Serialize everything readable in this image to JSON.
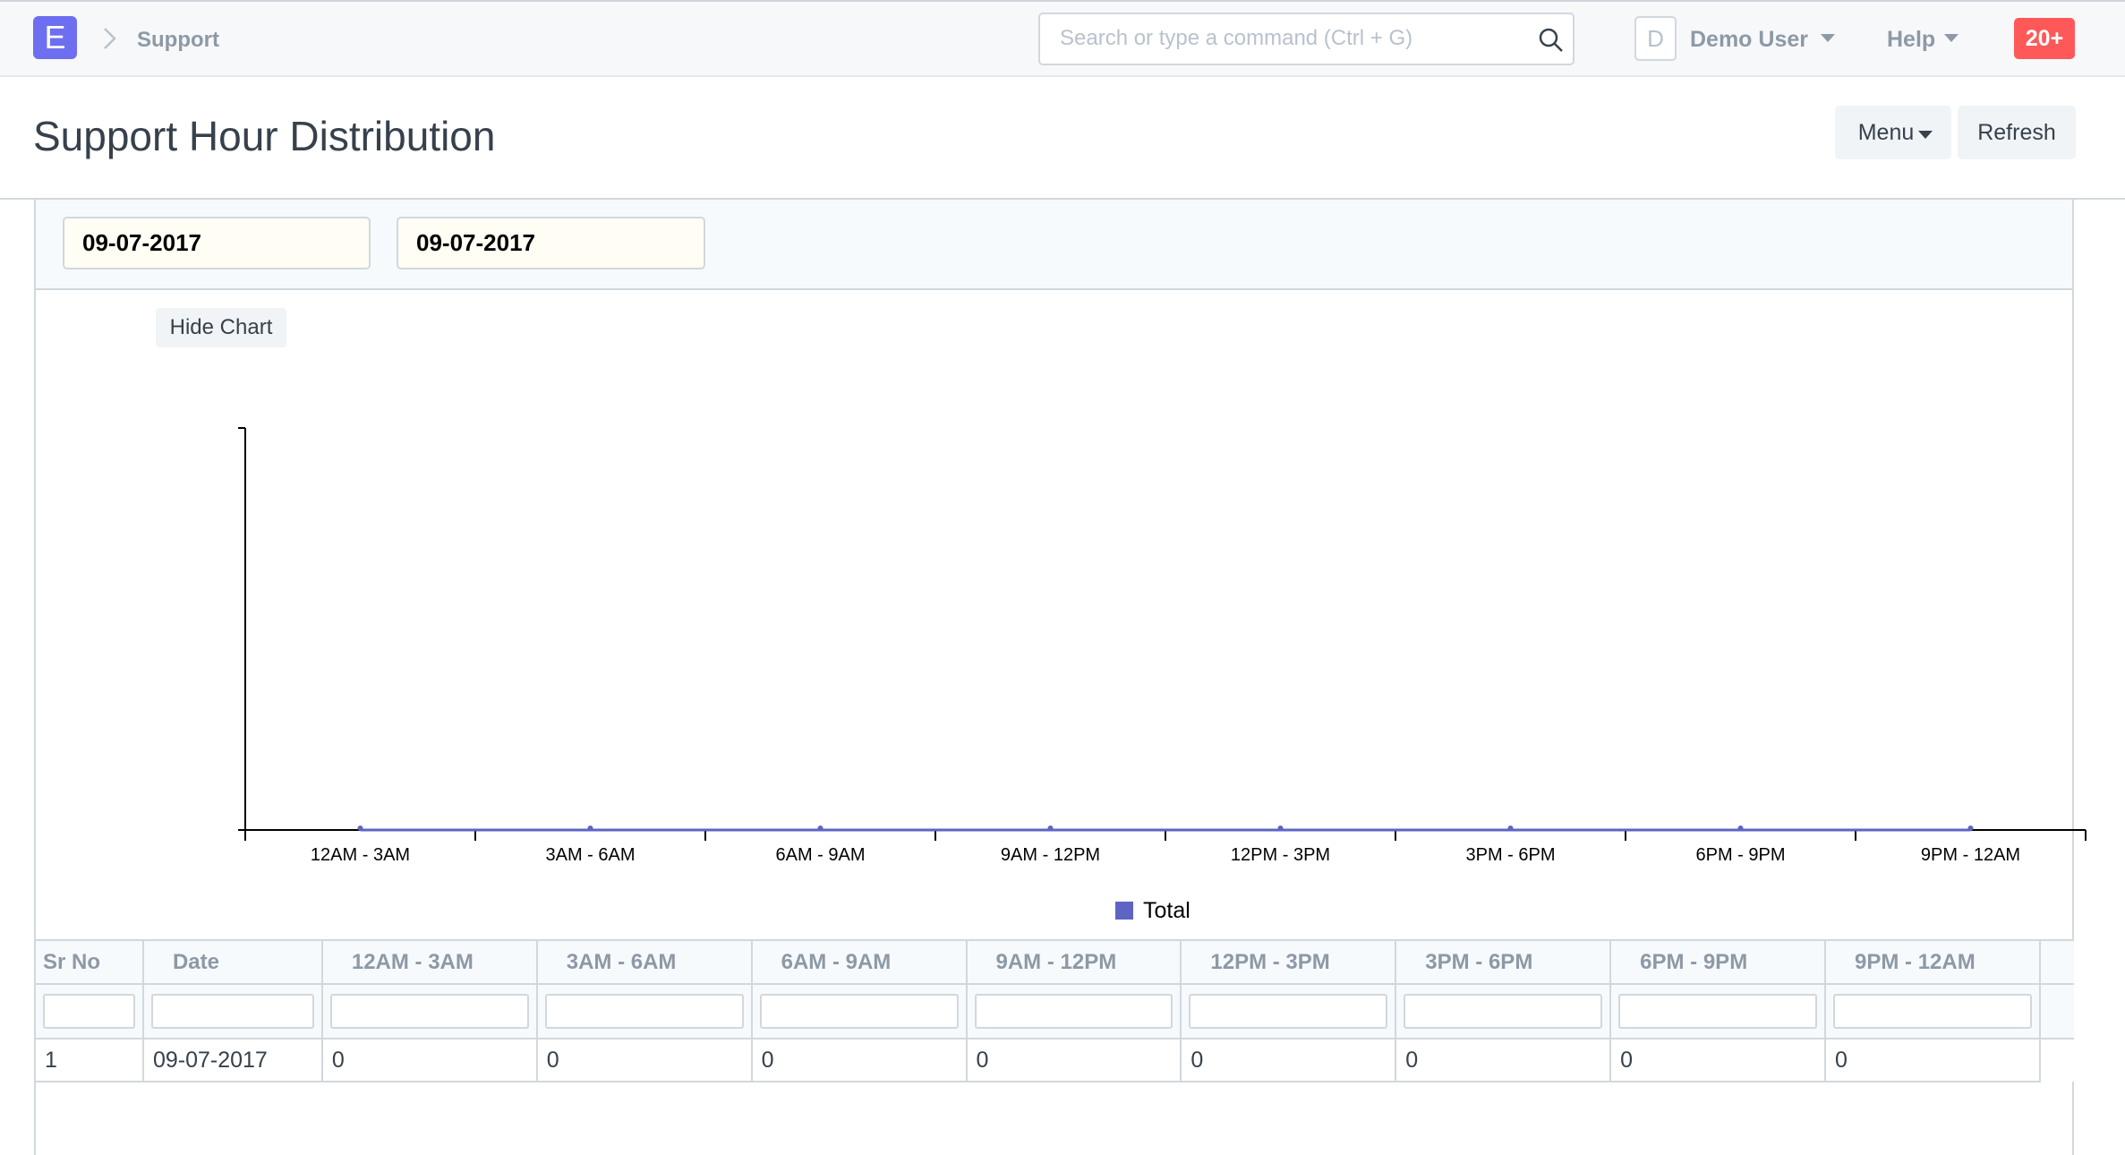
{
  "navbar": {
    "logo_letter": "E",
    "breadcrumb": "Support",
    "search_placeholder": "Search or type a command (Ctrl + G)",
    "avatar_initial": "D",
    "user_name": "Demo User",
    "help_label": "Help",
    "notifications": "20+"
  },
  "page": {
    "title": "Support Hour Distribution",
    "menu_label": "Menu",
    "refresh_label": "Refresh"
  },
  "filters": {
    "from_date": "09-07-2017",
    "to_date": "09-07-2017"
  },
  "hide_chart_label": "Hide Chart",
  "chart_data": {
    "type": "line",
    "title": "",
    "xlabel": "",
    "ylabel": "",
    "categories": [
      "12AM - 3AM",
      "3AM - 6AM",
      "6AM - 9AM",
      "9AM - 12PM",
      "12PM - 3PM",
      "3PM - 6PM",
      "6PM - 9PM",
      "9PM - 12AM"
    ],
    "series": [
      {
        "name": "Total",
        "values": [
          0,
          0,
          0,
          0,
          0,
          0,
          0,
          0
        ],
        "color": "#5e64c4"
      }
    ],
    "legend_position": "bottom-center",
    "grid": false
  },
  "table": {
    "columns": [
      "Sr No",
      "Date",
      "12AM - 3AM",
      "3AM - 6AM",
      "6AM - 9AM",
      "9AM - 12PM",
      "12PM - 3PM",
      "3PM - 6PM",
      "6PM - 9PM",
      "9PM - 12AM"
    ],
    "rows": [
      [
        "1",
        "09-07-2017",
        "0",
        "0",
        "0",
        "0",
        "0",
        "0",
        "0",
        "0"
      ]
    ]
  }
}
